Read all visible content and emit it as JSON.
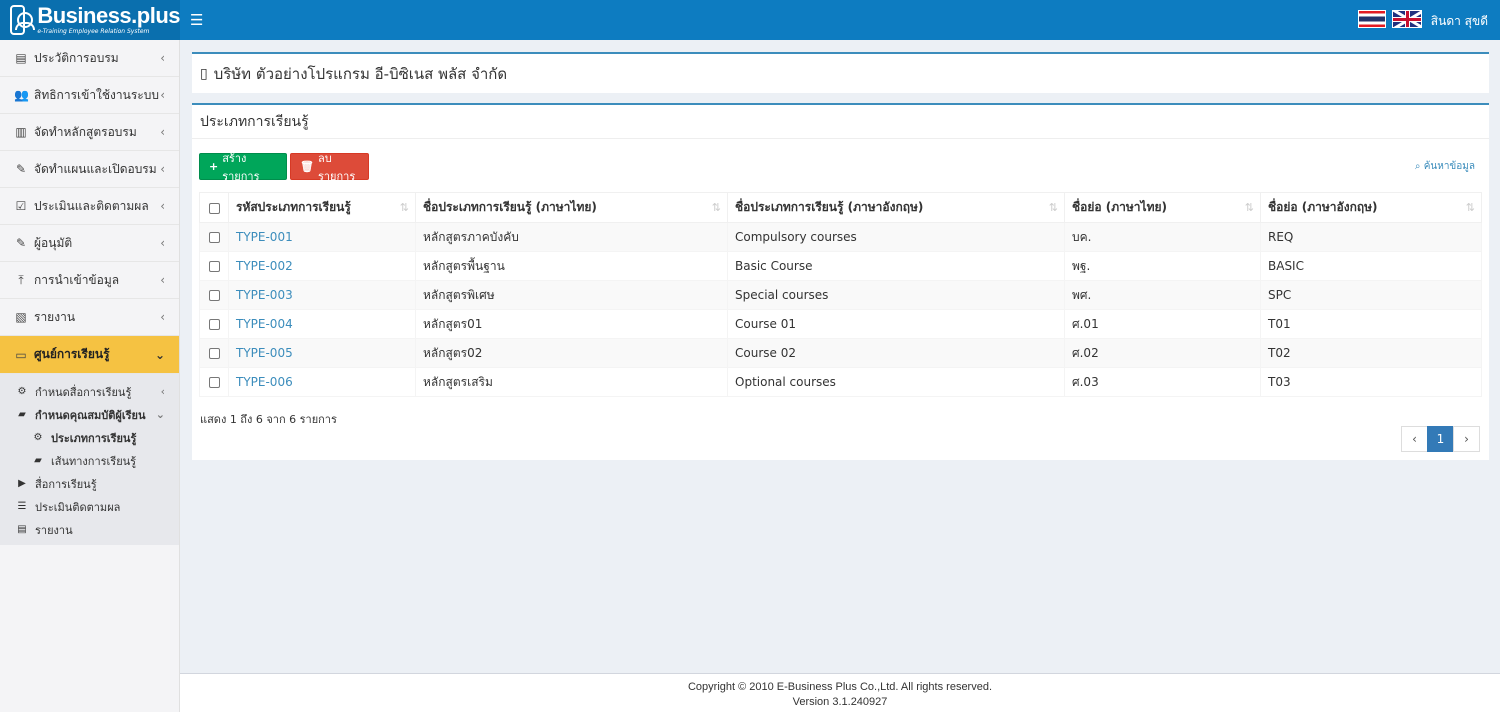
{
  "header": {
    "logo_brand": "Business.plus",
    "logo_tagline": "e-Training Employee Relation System",
    "menu_icon": "hamburger-icon",
    "user_name": "สินดา สุขดี"
  },
  "sidebar": {
    "items": [
      {
        "label": "ประวัติการอบรม",
        "icon": "file-icon"
      },
      {
        "label": "สิทธิการเข้าใช้งานระบบ",
        "icon": "users-icon"
      },
      {
        "label": "จัดทำหลักสูตรอบรม",
        "icon": "book-icon"
      },
      {
        "label": "จัดทำแผนและเปิดอบรม",
        "icon": "edit-icon"
      },
      {
        "label": "ประเมินและติดตามผล",
        "icon": "check-square-icon"
      },
      {
        "label": "ผู้อนุมัติ",
        "icon": "edit-icon"
      },
      {
        "label": "การนำเข้าข้อมูล",
        "icon": "upload-icon"
      },
      {
        "label": "รายงาน",
        "icon": "pdf-icon"
      },
      {
        "label": "ศูนย์การเรียนรู้",
        "icon": "monitor-icon"
      }
    ],
    "sub_items": [
      {
        "label": "กำหนดสื่อการเรียนรู้",
        "icon": "gear-icon"
      },
      {
        "label": "กำหนดคุณสมบัติผู้เรียน",
        "icon": "book-icon"
      },
      {
        "label": "ประเภทการเรียนรู้",
        "icon": "gear-icon"
      },
      {
        "label": "เส้นทางการเรียนรู้",
        "icon": "book-icon"
      },
      {
        "label": "สื่อการเรียนรู้",
        "icon": "video-icon"
      },
      {
        "label": "ประเมินติดตามผล",
        "icon": "list-icon"
      },
      {
        "label": "รายงาน",
        "icon": "file-icon"
      }
    ]
  },
  "company": {
    "name": "บริษัท ตัวอย่างโปรแกรม อี-บิซิเนส พลัส จำกัด"
  },
  "panel": {
    "title": "ประเภทการเรียนรู้",
    "create_label": "สร้างรายการ",
    "delete_label": "ลบรายการ",
    "search_label": "ค้นหาข้อมูล"
  },
  "table": {
    "headers": [
      "รหัสประเภทการเรียนรู้",
      "ชื่อประเภทการเรียนรู้ (ภาษาไทย)",
      "ชื่อประเภทการเรียนรู้ (ภาษาอังกฤษ)",
      "ชื่อย่อ (ภาษาไทย)",
      "ชื่อย่อ (ภาษาอังกฤษ)"
    ],
    "rows": [
      [
        "TYPE-001",
        "หลักสูตรภาคบังคับ",
        "Compulsory courses",
        "บค.",
        "REQ"
      ],
      [
        "TYPE-002",
        "หลักสูตรพื้นฐาน",
        "Basic Course",
        "พฐ.",
        "BASIC"
      ],
      [
        "TYPE-003",
        "หลักสูตรพิเศษ",
        "Special courses",
        "พศ.",
        "SPC"
      ],
      [
        "TYPE-004",
        "หลักสูตร01",
        "Course 01",
        "ศ.01",
        "T01"
      ],
      [
        "TYPE-005",
        "หลักสูตร02",
        "Course 02",
        "ศ.02",
        "T02"
      ],
      [
        "TYPE-006",
        "หลักสูตรเสริม",
        "Optional courses",
        "ศ.03",
        "T03"
      ]
    ],
    "showing": "แสดง 1 ถึง 6 จาก 6 รายการ",
    "current_page": "1"
  },
  "footer": {
    "copyright": "Copyright © 2010 E-Business Plus Co.,Ltd. All rights reserved.",
    "version": "Version 3.1.240927"
  }
}
